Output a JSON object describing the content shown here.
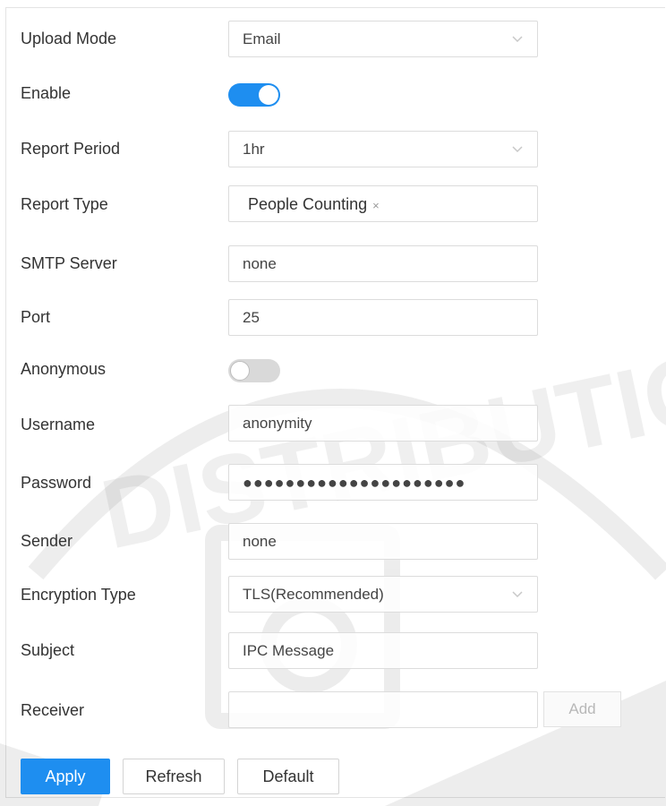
{
  "form": {
    "upload_mode": {
      "label": "Upload Mode",
      "value": "Email"
    },
    "enable": {
      "label": "Enable",
      "on": true
    },
    "report_period": {
      "label": "Report Period",
      "value": "1hr"
    },
    "report_type": {
      "label": "Report Type",
      "tag": "People Counting",
      "tag_remove": "×"
    },
    "smtp_server": {
      "label": "SMTP Server",
      "value": "none"
    },
    "port": {
      "label": "Port",
      "value": "25"
    },
    "anonymous": {
      "label": "Anonymous",
      "on": false
    },
    "username": {
      "label": "Username",
      "value": "anonymity"
    },
    "password": {
      "label": "Password",
      "value": "●●●●●●●●●●●●●●●●●●●●●"
    },
    "sender": {
      "label": "Sender",
      "value": "none"
    },
    "encryption_type": {
      "label": "Encryption Type",
      "value": "TLS(Recommended)"
    },
    "subject": {
      "label": "Subject",
      "value": "IPC Message"
    },
    "receiver": {
      "label": "Receiver",
      "value": "",
      "add_label": "Add"
    }
  },
  "actions": {
    "apply": "Apply",
    "refresh": "Refresh",
    "default": "Default"
  },
  "colors": {
    "accent": "#1e8ef0",
    "toggle_off": "#d9d9d9"
  }
}
